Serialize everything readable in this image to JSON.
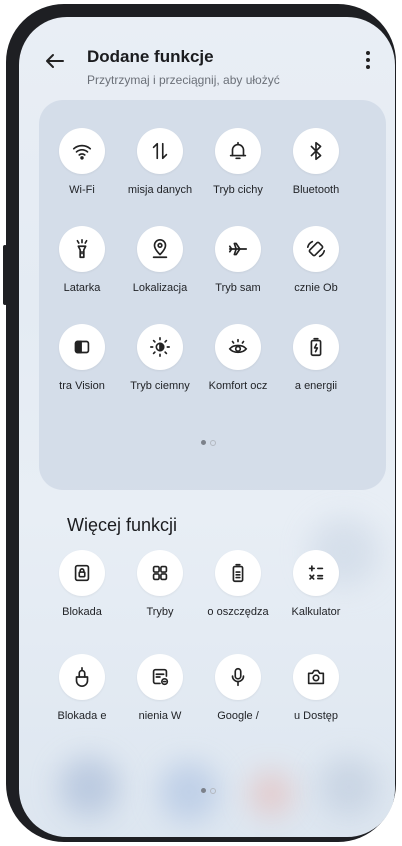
{
  "header": {
    "title": "Dodane funkcje",
    "subtitle": "Przytrzymaj i przeciągnij, aby ułożyć"
  },
  "added": {
    "tiles": [
      {
        "label": "Wi-Fi",
        "icon": "wifi-icon"
      },
      {
        "label": "misja danych",
        "icon": "data-transfer-icon"
      },
      {
        "label": "Tryb cichy",
        "icon": "bell-icon"
      },
      {
        "label": "Bluetooth",
        "icon": "bluetooth-icon"
      },
      {
        "label": "Latarka",
        "icon": "flashlight-icon"
      },
      {
        "label": "Lokalizacja",
        "icon": "location-icon"
      },
      {
        "label": "Tryb sam",
        "icon": "airplane-icon"
      },
      {
        "label": "cznie   Ob",
        "icon": "auto-rotate-icon"
      },
      {
        "label": "tra Vision",
        "icon": "vision-icon"
      },
      {
        "label": "Tryb ciemny",
        "icon": "dark-mode-icon"
      },
      {
        "label": "Komfort ocz",
        "icon": "eye-comfort-icon"
      },
      {
        "label": "a energii",
        "icon": "battery-saver-icon"
      }
    ]
  },
  "more": {
    "title": "Więcej funkcji",
    "tiles": [
      {
        "label": "Blokada",
        "icon": "lock-screen-icon"
      },
      {
        "label": "Tryby",
        "icon": "modes-icon"
      },
      {
        "label": "o oszczędza",
        "icon": "power-saving-icon"
      },
      {
        "label": "Kalkulator",
        "icon": "calculator-icon"
      },
      {
        "label": "Blokada e",
        "icon": "touch-lock-icon"
      },
      {
        "label": "nienia   W",
        "icon": "screen-record-icon"
      },
      {
        "label": "Google /",
        "icon": "microphone-icon"
      },
      {
        "label": "u   Dostęp",
        "icon": "camera-icon"
      }
    ]
  },
  "colors": {
    "panel": "#cdd7e4",
    "tile": "#ffffff",
    "frame": "#1e1f23",
    "text": "#1b1c1f"
  }
}
